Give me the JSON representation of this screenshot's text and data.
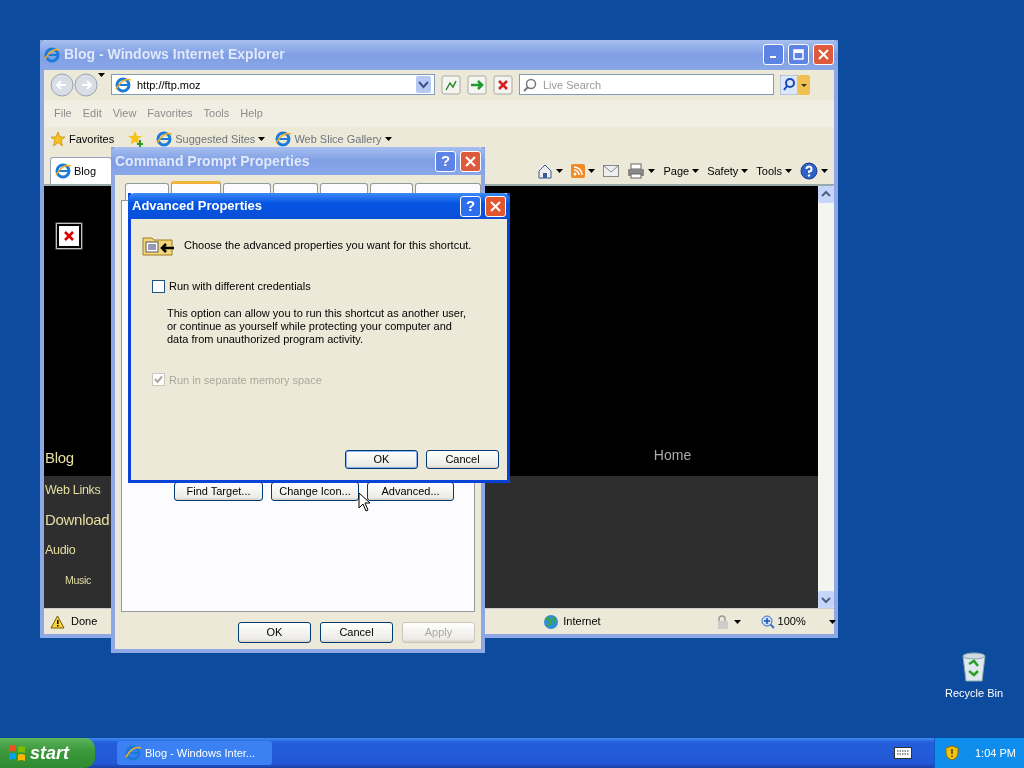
{
  "browser": {
    "title": "Blog - Windows Internet Explorer",
    "address": "http://ftp.moz",
    "search": {
      "placeholder": "Live Search"
    },
    "menu": [
      "File",
      "Edit",
      "View",
      "Favorites",
      "Tools",
      "Help"
    ],
    "favorites_bar": {
      "label": "Favorites",
      "links": [
        "Suggested Sites",
        "Web Slice Gallery"
      ]
    },
    "tab": {
      "label": "Blog",
      "selected": true
    },
    "commands": [
      "Page",
      "Safety",
      "Tools"
    ],
    "page": {
      "nav": [
        {
          "label": "Blog",
          "kind": "heading"
        },
        {
          "label": "Web Links",
          "kind": "link"
        },
        {
          "label": "Download",
          "kind": "heading"
        },
        {
          "label": "Audio",
          "kind": "link"
        },
        {
          "label": "Music",
          "kind": "sublink"
        }
      ],
      "home": "Home"
    },
    "status": {
      "text": "Done",
      "zone": "Internet",
      "zoom": "100%"
    }
  },
  "properties_dialog": {
    "title": "Command Prompt Properties",
    "help": "?",
    "tabs": [
      {
        "selected": false
      },
      {
        "selected": true
      },
      {
        "selected": false
      },
      {
        "selected": false
      },
      {
        "selected": false
      },
      {
        "selected": false
      },
      {
        "selected": false
      }
    ],
    "buttons": [
      "Find Target...",
      "Change Icon...",
      "Advanced..."
    ],
    "footer": [
      {
        "label": "OK",
        "disabled": false
      },
      {
        "label": "Cancel",
        "disabled": false
      },
      {
        "label": "Apply",
        "disabled": true
      }
    ]
  },
  "advanced_dialog": {
    "title": "Advanced Properties",
    "help": "?",
    "intro": "Choose the advanced properties you want for this shortcut.",
    "options": [
      {
        "label": "Run with different credentials",
        "checked": false,
        "disabled": false,
        "description": "This option can allow you to run this shortcut as another user, or continue as yourself while protecting your computer and data from unauthorized program activity."
      },
      {
        "label": "Run in separate memory space",
        "checked": true,
        "disabled": true
      }
    ],
    "buttons": [
      "OK",
      "Cancel"
    ]
  },
  "desktop_icons": [
    {
      "label": "Recycle Bin"
    }
  ],
  "taskbar": {
    "start": "start",
    "tasks": [
      {
        "label": "Blog - Windows Inter...",
        "selected": false
      }
    ],
    "clock": "1:04 PM"
  }
}
